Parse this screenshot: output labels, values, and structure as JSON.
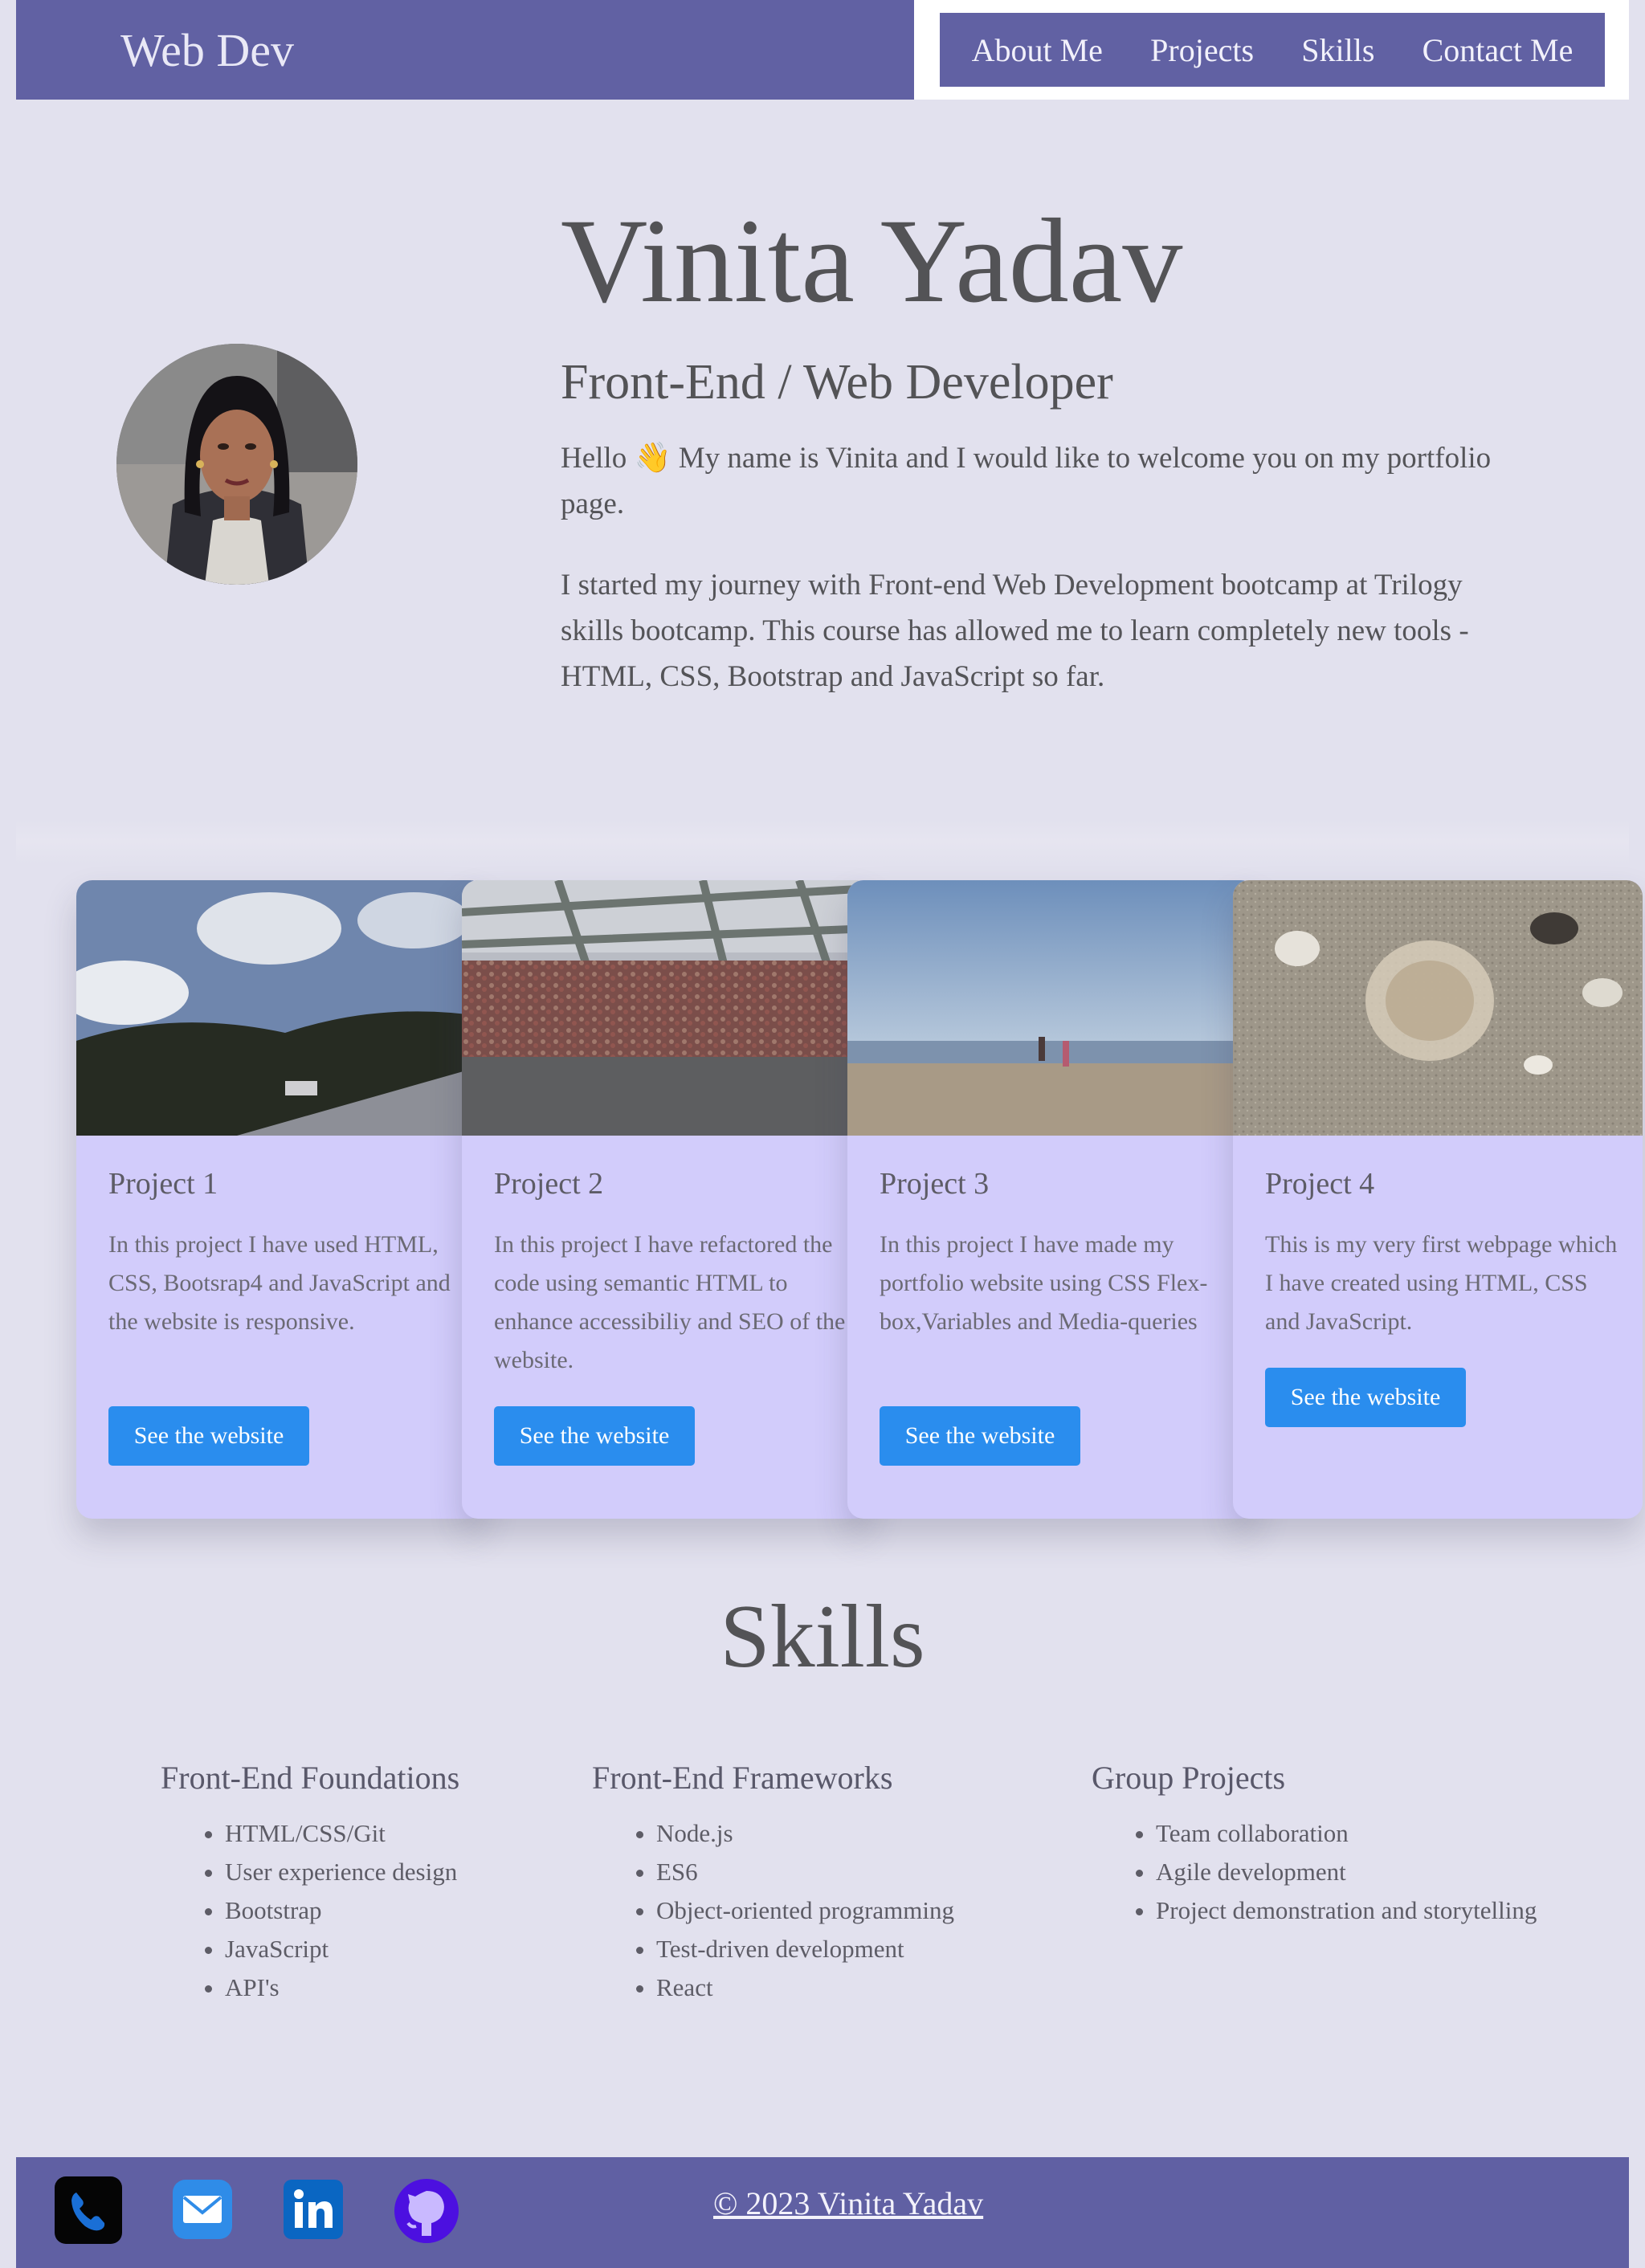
{
  "header": {
    "brand": "Web Dev",
    "nav": [
      "About Me",
      "Projects",
      "Skills",
      "Contact Me"
    ]
  },
  "hero": {
    "name": "Vinita Yadav",
    "role": "Front-End / Web Developer",
    "greeting": "Hello 👋 My name is Vinita and I would like to welcome you on my portfolio page.",
    "intro": "I started my journey with Front-end Web Development bootcamp at Trilogy skills bootcamp. This course has allowed me to learn completely new tools - HTML, CSS, Bootstrap and JavaScript so far."
  },
  "projects": [
    {
      "title": "Project 1",
      "description": "In this project I have used HTML, CSS, Bootsrap4 and JavaScript and the website is responsive.",
      "button": "See the website"
    },
    {
      "title": "Project 2",
      "description": "In this project I have refactored the code using semantic HTML to enhance accessibiliy and SEO of the website.",
      "button": "See the website"
    },
    {
      "title": "Project 3",
      "description": "In this project I have made my portfolio website using CSS Flex-box,Variables and Media-queries",
      "button": "See the website"
    },
    {
      "title": "Project 4",
      "description": "This is my very first webpage which I have created using HTML, CSS and JavaScript.",
      "button": "See the website"
    }
  ],
  "skills": {
    "title": "Skills",
    "groups": [
      {
        "heading": "Front-End Foundations",
        "items": [
          "HTML/CSS/Git",
          "User experience design",
          "Bootstrap",
          "JavaScript",
          "API's"
        ]
      },
      {
        "heading": "Front-End Frameworks",
        "items": [
          "Node.js",
          "ES6",
          "Object-oriented programming",
          "Test-driven development",
          "React"
        ]
      },
      {
        "heading": "Group Projects",
        "items": [
          "Team collaboration",
          "Agile development",
          "Project demonstration and storytelling"
        ]
      }
    ]
  },
  "footer": {
    "icons": [
      "phone-icon",
      "email-icon",
      "linkedin-icon",
      "github-icon"
    ],
    "copyright": "© 2023 Vinita Yadav"
  },
  "colors": {
    "header": "#6161a3",
    "background": "#e2e1ee",
    "card": "#d2ccfb",
    "button": "#2a8dee"
  }
}
